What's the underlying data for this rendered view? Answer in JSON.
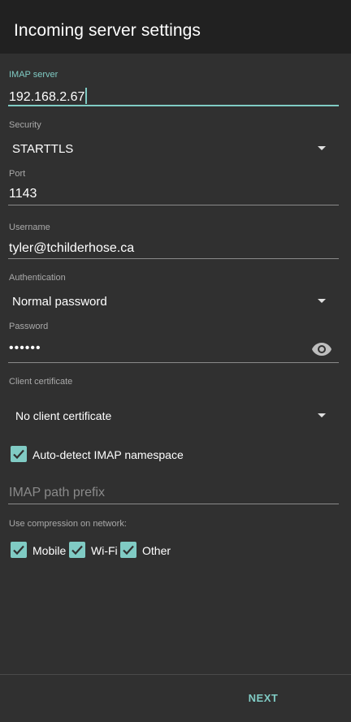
{
  "appbar": {
    "title": "Incoming server settings"
  },
  "imap_server": {
    "label": "IMAP server",
    "value": "192.168.2.67"
  },
  "security": {
    "label": "Security",
    "value": "STARTTLS"
  },
  "port": {
    "label": "Port",
    "value": "1143"
  },
  "username": {
    "label": "Username",
    "value": "tyler@tchilderhose.ca"
  },
  "authentication": {
    "label": "Authentication",
    "value": "Normal password"
  },
  "password": {
    "label": "Password",
    "value": "••••••",
    "toggle_icon": "eye-icon"
  },
  "client_certificate": {
    "label": "Client certificate",
    "value": "No client certificate"
  },
  "auto_detect": {
    "label": "Auto-detect IMAP namespace",
    "checked": true
  },
  "imap_path_prefix": {
    "placeholder": "IMAP path prefix"
  },
  "compression": {
    "label": "Use compression on network:",
    "options": [
      {
        "label": "Mobile",
        "checked": true
      },
      {
        "label": "Wi-Fi",
        "checked": true
      },
      {
        "label": "Other",
        "checked": true
      }
    ]
  },
  "footer": {
    "next_label": "NEXT"
  },
  "colors": {
    "accent": "#80cbc4",
    "background": "#303030",
    "appbar": "#212121"
  }
}
